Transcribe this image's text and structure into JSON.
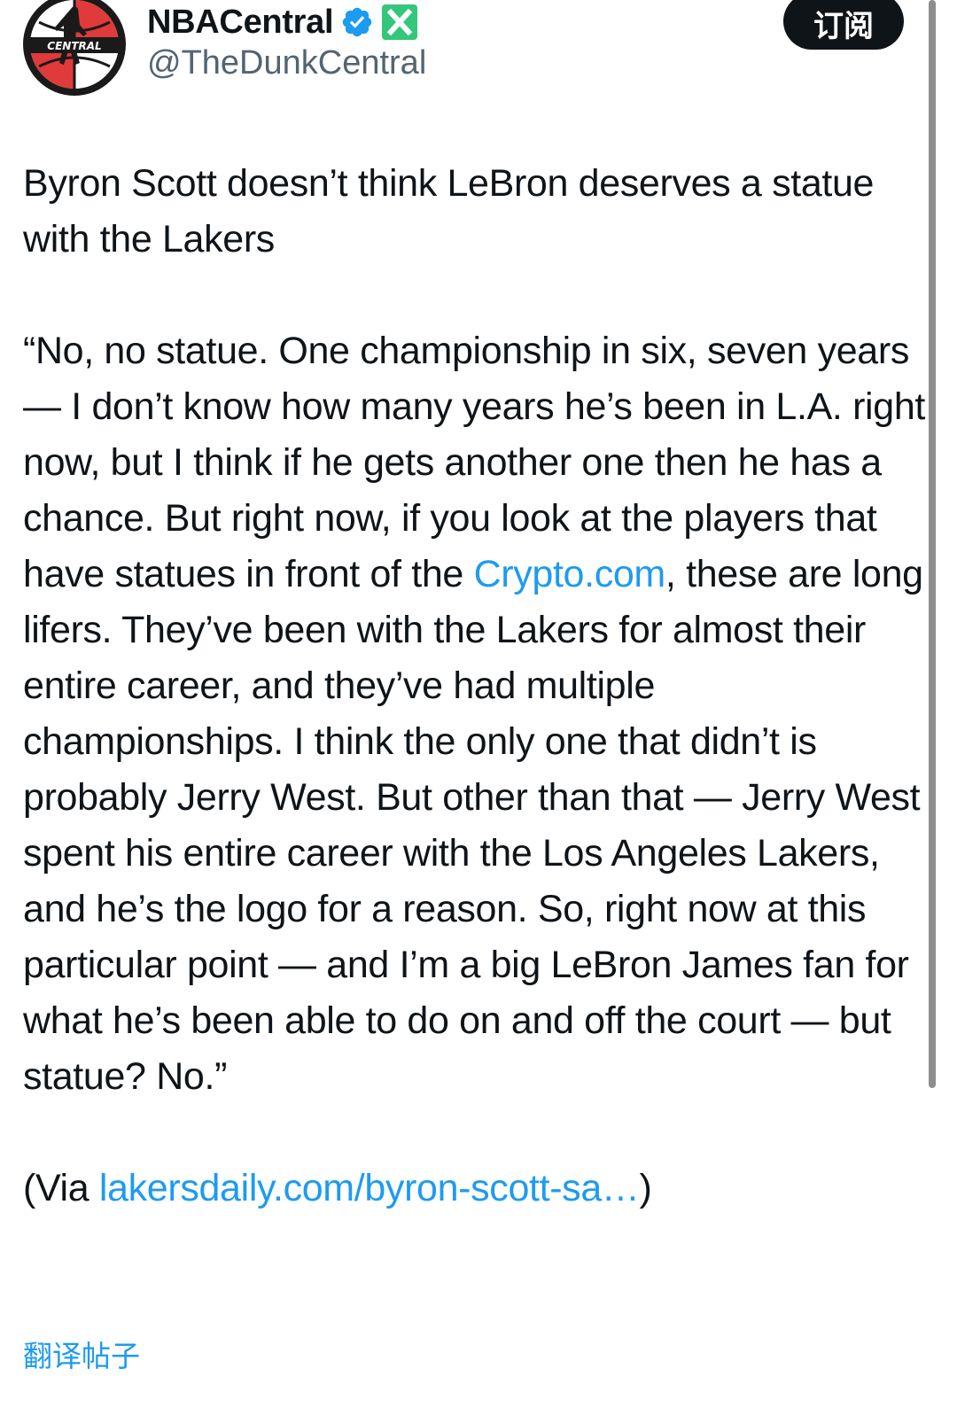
{
  "author": {
    "display_name": "NBACentral",
    "handle": "@TheDunkCentral",
    "avatar_icon": "nba-central-logo",
    "verified_icon": "verified-badge-icon",
    "affiliate_icon": "x-affiliate-badge-icon",
    "avatar_text": "CENTRAL"
  },
  "subscribe_label": "订阅",
  "tweet": {
    "headline": "Byron Scott doesn’t think LeBron deserves a statue with the Lakers",
    "quote_part1": "“No, no statue. One championship in six, seven years — I don’t know how many years he’s been in L.A. right now, but I think if he gets another one then he has a chance. But right now, if you look at the players that have statues in front of the ",
    "quote_link": "Crypto.com",
    "quote_part2": ", these are long lifers. They’ve been with the Lakers for almost their entire career, and they’ve had multiple championships. I think the only one that didn’t is probably Jerry West. But other than that — Jerry West spent his entire career with the Los Angeles Lakers, and he’s the logo for a reason. So, right now at this particular point — and I’m a big LeBron James fan for what he’s been able to do on and off the court — but statue? No.”",
    "via_prefix": "(Via ",
    "via_link": "lakersdaily.com/byron-scott-sa…",
    "via_suffix": ")"
  },
  "translate_label": "翻译帖子",
  "colors": {
    "text": "#0f1419",
    "secondary": "#536471",
    "link": "#1d9bf0",
    "button_bg": "#0f1419",
    "verified": "#1d9bf0",
    "affiliate_badge": "#34c77b"
  }
}
